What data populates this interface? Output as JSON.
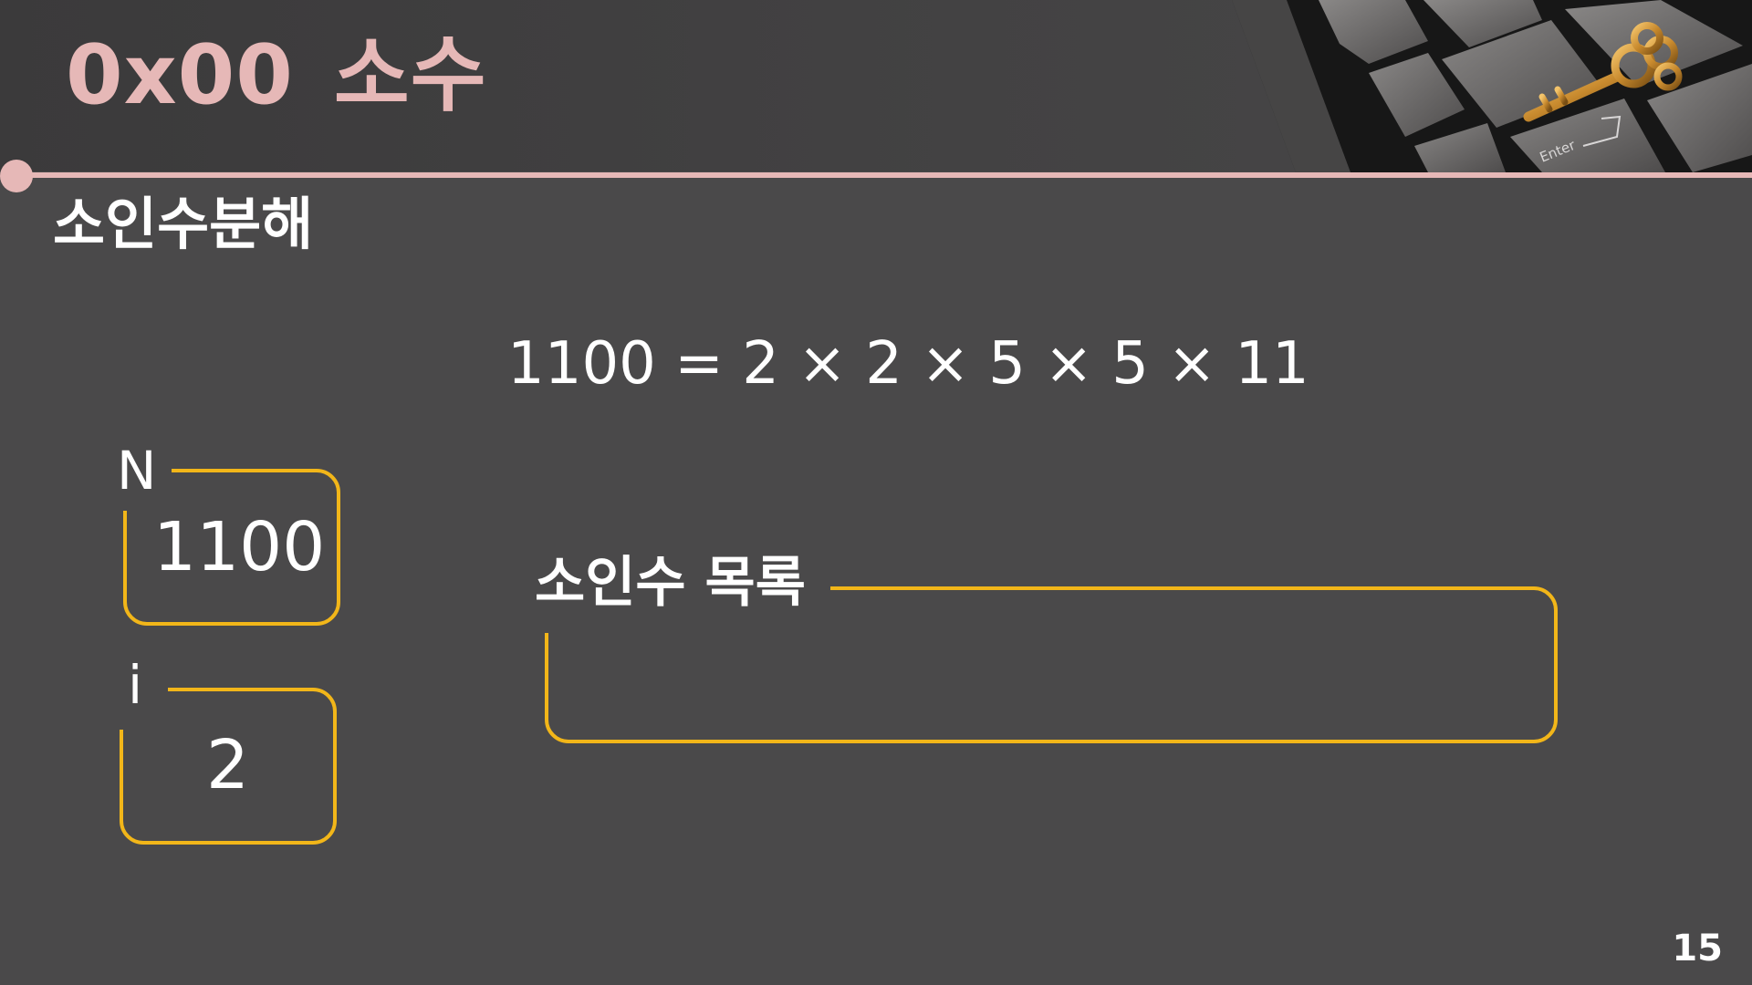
{
  "slide": {
    "title_code": "0x00",
    "title_text": "소수",
    "subtitle": "소인수분해",
    "equation": "1100 = 2 × 2 × 5 × 5 × 11",
    "page_number": "15"
  },
  "variables": {
    "n": {
      "label": "N",
      "value": "1100"
    },
    "i": {
      "label": "i",
      "value": "2"
    }
  },
  "factor_list": {
    "label": "소인수 목록",
    "items": []
  },
  "decor": {
    "keyboard_key_label": "Enter"
  },
  "colors": {
    "background": "#4a494a",
    "header": "#3b3a3b",
    "title": "#e6b8b7",
    "accent_line": "#e6b8b7",
    "box_border": "#f2b619",
    "text": "#ffffff"
  }
}
